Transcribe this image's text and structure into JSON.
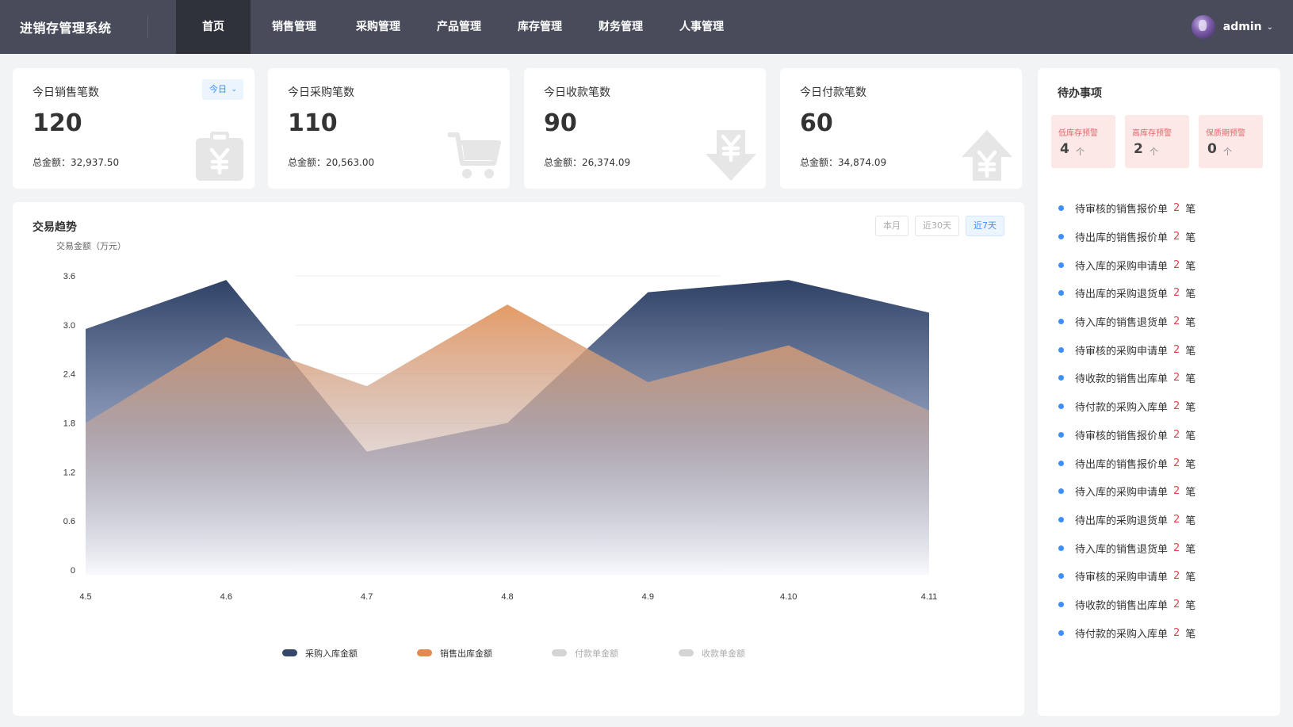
{
  "header": {
    "brand": "进销存管理系统",
    "nav": [
      {
        "label": "首页",
        "active": true
      },
      {
        "label": "销售管理",
        "active": false
      },
      {
        "label": "采购管理",
        "active": false
      },
      {
        "label": "产品管理",
        "active": false
      },
      {
        "label": "库存管理",
        "active": false
      },
      {
        "label": "财务管理",
        "active": false
      },
      {
        "label": "人事管理",
        "active": false
      }
    ],
    "user": {
      "name": "admin",
      "caret_icon": "chevron-down-icon"
    }
  },
  "stats": [
    {
      "title": "今日销售笔数",
      "value": "120",
      "total_label": "总金额：",
      "total_value": "32,937.50",
      "icon": "clipboard-yen-icon",
      "filter": "今日"
    },
    {
      "title": "今日采购笔数",
      "value": "110",
      "total_label": "总金额：",
      "total_value": "20,563.00",
      "icon": "cart-icon"
    },
    {
      "title": "今日收款笔数",
      "value": "90",
      "total_label": "总金额：",
      "total_value": "26,374.09",
      "icon": "yen-down-arrow-icon"
    },
    {
      "title": "今日付款笔数",
      "value": "60",
      "total_label": "总金额：",
      "total_value": "34,874.09",
      "icon": "yen-up-arrow-icon"
    }
  ],
  "trend": {
    "title": "交易趋势",
    "ranges": [
      {
        "label": "本月",
        "active": false
      },
      {
        "label": "近30天",
        "active": false
      },
      {
        "label": "近7天",
        "active": true
      }
    ]
  },
  "chart_data": {
    "type": "area",
    "ylabel": "交易金额（万元）",
    "ylim": [
      0,
      3.6
    ],
    "yticks": [
      "0",
      "0.6",
      "1.2",
      "1.8",
      "2.4",
      "3.0",
      "3.6"
    ],
    "x": [
      "4.5",
      "4.6",
      "4.7",
      "4.8",
      "4.9",
      "4.10",
      "4.11"
    ],
    "grid": true,
    "legend_position": "bottom",
    "series": [
      {
        "name": "采购入库金额",
        "color": "#35476a",
        "visible": true,
        "values": [
          2.95,
          3.55,
          1.45,
          1.8,
          3.4,
          3.55,
          3.15
        ]
      },
      {
        "name": "销售出库金额",
        "color": "#e38a4e",
        "visible": true,
        "values": [
          1.8,
          2.85,
          2.25,
          3.25,
          2.3,
          2.75,
          1.95
        ]
      },
      {
        "name": "付款单金额",
        "color": "#d4d4d4",
        "visible": false,
        "values": []
      },
      {
        "name": "收款单金额",
        "color": "#d4d4d4",
        "visible": false,
        "values": []
      }
    ]
  },
  "todo": {
    "title": "待办事项",
    "alerts": [
      {
        "label": "低库存预警",
        "count": "4",
        "unit": "个"
      },
      {
        "label": "高库存预警",
        "count": "2",
        "unit": "个"
      },
      {
        "label": "保质期预警",
        "count": "0",
        "unit": "个"
      }
    ],
    "items": [
      {
        "text": "待审核的销售报价单",
        "count": "2",
        "unit": "笔"
      },
      {
        "text": "待出库的销售报价单",
        "count": "2",
        "unit": "笔"
      },
      {
        "text": "待入库的采购申请单",
        "count": "2",
        "unit": "笔"
      },
      {
        "text": "待出库的采购退货单",
        "count": "2",
        "unit": "笔"
      },
      {
        "text": "待入库的销售退货单",
        "count": "2",
        "unit": "笔"
      },
      {
        "text": "待审核的采购申请单",
        "count": "2",
        "unit": "笔"
      },
      {
        "text": "待收款的销售出库单",
        "count": "2",
        "unit": "笔"
      },
      {
        "text": "待付款的采购入库单",
        "count": "2",
        "unit": "笔"
      },
      {
        "text": "待审核的销售报价单",
        "count": "2",
        "unit": "笔"
      },
      {
        "text": "待出库的销售报价单",
        "count": "2",
        "unit": "笔"
      },
      {
        "text": "待入库的采购申请单",
        "count": "2",
        "unit": "笔"
      },
      {
        "text": "待出库的采购退货单",
        "count": "2",
        "unit": "笔"
      },
      {
        "text": "待入库的销售退货单",
        "count": "2",
        "unit": "笔"
      },
      {
        "text": "待审核的采购申请单",
        "count": "2",
        "unit": "笔"
      },
      {
        "text": "待收款的销售出库单",
        "count": "2",
        "unit": "笔"
      },
      {
        "text": "待付款的采购入库单",
        "count": "2",
        "unit": "笔"
      }
    ]
  }
}
